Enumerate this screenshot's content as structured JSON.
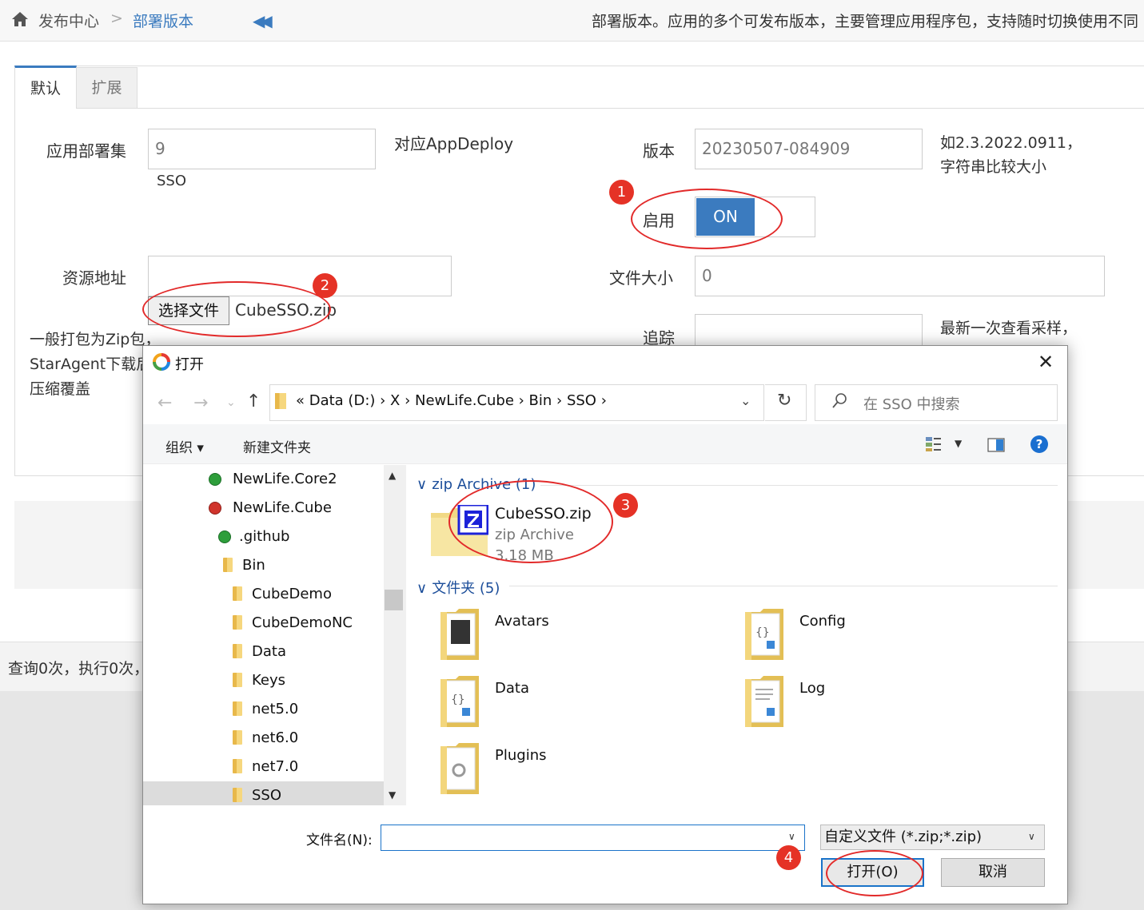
{
  "header": {
    "breadcrumb_root": "发布中心",
    "breadcrumb_sep": ">",
    "breadcrumb_current": "部署版本",
    "collapse_glyph": "◀◀",
    "description": "部署版本。应用的多个可发布版本，主要管理应用程序包，支持随时切换使用不同"
  },
  "tabs": [
    "默认",
    "扩展"
  ],
  "form": {
    "app_label": "应用部署集",
    "app_value": "9",
    "app_sub": "SSO",
    "app_hint": "对应AppDeploy",
    "version_label": "版本",
    "version_value": "20230507-084909",
    "version_hint_1": "如2.3.2022.0911，",
    "version_hint_2": "字符串比较大小",
    "enable_label": "启用",
    "enable_value": "ON",
    "resource_label": "资源地址",
    "resource_value": "",
    "choose_file_label": "选择文件",
    "chosen_file": "CubeSSO.zip",
    "resource_hint_1": "一般打包为Zip包，",
    "resource_hint_2": "StarAgent下载后",
    "resource_hint_3": "压缩覆盖",
    "size_label": "文件大小",
    "size_value": "0",
    "trace_label": "追踪",
    "trace_hint": "最新一次查看采样，"
  },
  "footer": {
    "stats": "查询0次，执行0次，"
  },
  "dialog": {
    "title": "打开",
    "close_glyph": "✕",
    "nav_back": "←",
    "nav_forward": "→",
    "nav_dropdown": "⌄",
    "nav_up": "↑",
    "address": "«  Data (D:)  ›  X  ›  NewLife.Cube  ›  Bin  ›  SSO  ›",
    "address_dropdown": "⌄",
    "refresh_glyph": "↻",
    "search_placeholder": "在 SSO 中搜索",
    "organize": "组织 ▾",
    "new_folder": "新建文件夹",
    "view_dropdown": "▼",
    "help_glyph": "?",
    "tree": [
      {
        "label": "NewLife.Core2",
        "kind": "status-ok"
      },
      {
        "label": "NewLife.Cube",
        "kind": "status-error"
      },
      {
        "label": ".github",
        "kind": "status-ok"
      },
      {
        "label": "Bin",
        "kind": "folder"
      },
      {
        "label": "CubeDemo",
        "kind": "folder"
      },
      {
        "label": "CubeDemoNC",
        "kind": "folder"
      },
      {
        "label": "Data",
        "kind": "folder"
      },
      {
        "label": "Keys",
        "kind": "folder"
      },
      {
        "label": "net5.0",
        "kind": "folder"
      },
      {
        "label": "net6.0",
        "kind": "folder"
      },
      {
        "label": "net7.0",
        "kind": "folder"
      },
      {
        "label": "SSO",
        "kind": "folder",
        "selected": true
      }
    ],
    "scroll_up": "▲",
    "scroll_down": "▼",
    "group_zip": "zip Archive (1)",
    "group_zip_chevron": "∨",
    "zip_file": {
      "name": "CubeSSO.zip",
      "type": "zip Archive",
      "size": "3.18 MB"
    },
    "group_folders": "文件夹 (5)",
    "group_folders_chevron": "∨",
    "folders": [
      "Avatars",
      "Config",
      "Data",
      "Log",
      "Plugins"
    ],
    "filename_label": "文件名(N):",
    "filename_value": "",
    "filename_dropdown": "∨",
    "filter": "自定义文件 (*.zip;*.zip)",
    "filter_dropdown": "∨",
    "open_button": "打开(O)",
    "cancel_button": "取消"
  },
  "annotations": [
    "1",
    "2",
    "3",
    "4"
  ],
  "colors": {
    "accent": "#3b7bbf",
    "annotation_red": "#e22a2a",
    "dialog_link": "#1c4e9a"
  }
}
